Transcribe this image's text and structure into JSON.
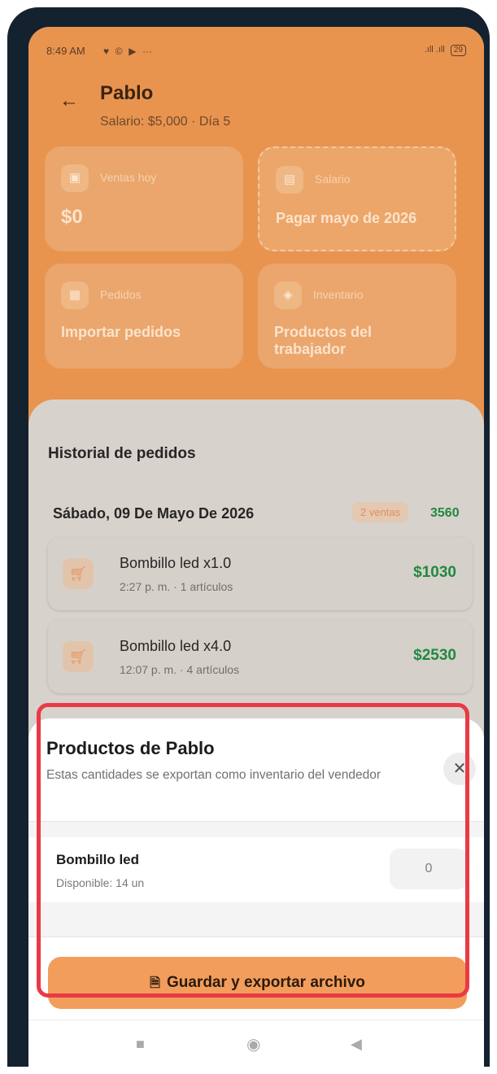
{
  "status_bar": {
    "time": "8:49 AM",
    "icons_left": [
      "♥",
      "©",
      "▶",
      "···"
    ],
    "signal": ".ıll .ıll",
    "battery": "29"
  },
  "header": {
    "title": "Pablo",
    "subtitle": "Salario: $5,000 · Día 5"
  },
  "cards": {
    "sales": {
      "label": "Ventas hoy",
      "value": "$0",
      "icon": "cash-icon"
    },
    "salary": {
      "label": "Salario",
      "value": "Pagar mayo de 2026",
      "icon": "id-card-icon"
    },
    "orders": {
      "label": "Pedidos",
      "value": "Importar pedidos",
      "icon": "file-icon"
    },
    "inventory": {
      "label": "Inventario",
      "value_line1": "Productos del",
      "value_line2": "trabajador",
      "icon": "box-icon"
    }
  },
  "history": {
    "title": "Historial de pedidos",
    "date": "Sábado, 09 De Mayo De 2026",
    "count_badge": "2 ventas",
    "total": "3560",
    "orders": [
      {
        "name": "Bombillo led x1.0",
        "meta": "2:27 p. m. · 1 artículos",
        "amount": "$1030"
      },
      {
        "name": "Bombillo led x4.0",
        "meta": "12:07 p. m. · 4 artículos",
        "amount": "$2530"
      }
    ]
  },
  "modal": {
    "title": "Productos de Pablo",
    "description": "Estas cantidades se exportan como inventario del vendedor",
    "close": "✕",
    "product": {
      "name": "Bombillo led",
      "available": "Disponible: 14 un",
      "quantity": "0"
    },
    "save_label": "Guardar y exportar archivo"
  },
  "nav": {
    "recent": "■",
    "home": "◉",
    "back": "◀"
  },
  "colors": {
    "accent": "#f39d5c",
    "highlight": "#ea3a44",
    "success": "#1f8a3f"
  }
}
